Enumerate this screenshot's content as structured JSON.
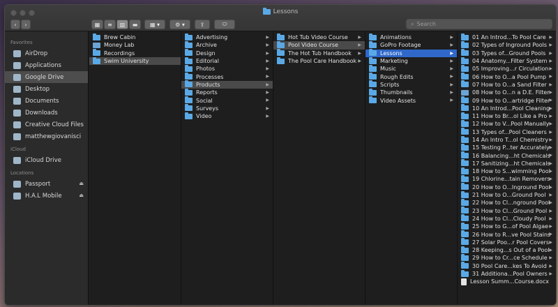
{
  "window": {
    "title": "Lessons"
  },
  "toolbar": {
    "back_label": "‹",
    "forward_label": "›",
    "view_icon_label": "▦",
    "view_list_label": "≡",
    "view_columns_label": "▥",
    "view_gallery_label": "▬",
    "group_label": "▦ ▾",
    "action_label": "⚙ ▾",
    "share_label": "⇪",
    "tag_label": "⬭",
    "search_placeholder": "Search"
  },
  "sidebar": {
    "sections": [
      {
        "heading": "Favorites",
        "items": [
          {
            "label": "AirDrop",
            "icon": "airdrop-icon"
          },
          {
            "label": "Applications",
            "icon": "applications-icon"
          },
          {
            "label": "Google Drive",
            "icon": "folder-icon",
            "selected": true
          },
          {
            "label": "Desktop",
            "icon": "desktop-icon"
          },
          {
            "label": "Documents",
            "icon": "documents-icon"
          },
          {
            "label": "Downloads",
            "icon": "downloads-icon"
          },
          {
            "label": "Creative Cloud Files",
            "icon": "creative-cloud-icon"
          },
          {
            "label": "matthewgiovanisci",
            "icon": "home-icon"
          }
        ]
      },
      {
        "heading": "iCloud",
        "items": [
          {
            "label": "iCloud Drive",
            "icon": "icloud-icon"
          }
        ]
      },
      {
        "heading": "Locations",
        "items": [
          {
            "label": "Passport",
            "icon": "disk-icon",
            "eject": true
          },
          {
            "label": "H.A.L Mobile",
            "icon": "disk-icon",
            "eject": true
          }
        ]
      }
    ]
  },
  "columns": [
    {
      "items": [
        {
          "label": "Brew Cabin",
          "icon": "folder"
        },
        {
          "label": "Money Lab",
          "icon": "picture"
        },
        {
          "label": "Recordings",
          "icon": "folder"
        },
        {
          "label": "Swim University",
          "icon": "folder",
          "selected": true
        }
      ]
    },
    {
      "items": [
        {
          "label": "Advertising",
          "icon": "folder",
          "chevron": true
        },
        {
          "label": "Archive",
          "icon": "folder",
          "chevron": true
        },
        {
          "label": "Design",
          "icon": "folder",
          "chevron": true
        },
        {
          "label": "Editorial",
          "icon": "folder",
          "chevron": true
        },
        {
          "label": "Photos",
          "icon": "folder",
          "chevron": true
        },
        {
          "label": "Processes",
          "icon": "folder",
          "chevron": true
        },
        {
          "label": "Products",
          "icon": "folder",
          "chevron": true,
          "selected": true
        },
        {
          "label": "Reports",
          "icon": "folder",
          "chevron": true
        },
        {
          "label": "Social",
          "icon": "folder",
          "chevron": true
        },
        {
          "label": "Surveys",
          "icon": "folder",
          "chevron": true
        },
        {
          "label": "Video",
          "icon": "folder",
          "chevron": true
        }
      ]
    },
    {
      "items": [
        {
          "label": "Hot Tub Video Course",
          "icon": "folder",
          "chevron": true
        },
        {
          "label": "Pool Video Course",
          "icon": "folder",
          "chevron": true,
          "selected": true
        },
        {
          "label": "The Hot Tub Handbook",
          "icon": "folder",
          "chevron": true
        },
        {
          "label": "The Pool Care Handbook",
          "icon": "folder",
          "chevron": true
        }
      ]
    },
    {
      "items": [
        {
          "label": "Animations",
          "icon": "folder",
          "chevron": true
        },
        {
          "label": "GoPro Footage",
          "icon": "folder",
          "chevron": true
        },
        {
          "label": "Lessons",
          "icon": "folder",
          "chevron": true,
          "active": true
        },
        {
          "label": "Marketing",
          "icon": "folder",
          "chevron": true
        },
        {
          "label": "Music",
          "icon": "folder",
          "chevron": true
        },
        {
          "label": "Rough Edits",
          "icon": "folder",
          "chevron": true
        },
        {
          "label": "Scripts",
          "icon": "folder",
          "chevron": true
        },
        {
          "label": "Thumbnails",
          "icon": "folder",
          "chevron": true
        },
        {
          "label": "Video Assets",
          "icon": "folder",
          "chevron": true
        }
      ]
    },
    {
      "items": [
        {
          "label": "01 An Introd...To Pool Care",
          "icon": "folder",
          "chevron": true
        },
        {
          "label": "02 Types of Inground Pools",
          "icon": "folder",
          "chevron": true
        },
        {
          "label": "03 Types of...Ground Pools",
          "icon": "folder",
          "chevron": true
        },
        {
          "label": "04 Anatomy...Filter System",
          "icon": "folder",
          "chevron": true
        },
        {
          "label": "05 Improving...r Circulation",
          "icon": "folder",
          "chevron": true
        },
        {
          "label": "06 How to O...a Pool Pump",
          "icon": "folder",
          "chevron": true
        },
        {
          "label": "07 How to O...a Sand Filter",
          "icon": "folder",
          "chevron": true
        },
        {
          "label": "08 How to O...n a D.E. Filter",
          "icon": "picture",
          "chevron": true
        },
        {
          "label": "09 How to O...artridge Filter",
          "icon": "folder",
          "chevron": true
        },
        {
          "label": "10 An Introd...Pool Cleaning",
          "icon": "folder",
          "chevron": true
        },
        {
          "label": "11 How to Br...ol Like a Pro",
          "icon": "folder",
          "chevron": true
        },
        {
          "label": "12 How to V...Pool Manually",
          "icon": "folder",
          "chevron": true
        },
        {
          "label": "13 Types of...Pool Cleaners",
          "icon": "folder",
          "chevron": true
        },
        {
          "label": "14 An Intro T...ol Chemistry",
          "icon": "folder",
          "chevron": true
        },
        {
          "label": "15 Testing P...ter Accurately",
          "icon": "folder",
          "chevron": true
        },
        {
          "label": "16 Balancing...ht Chemicals",
          "icon": "folder",
          "chevron": true
        },
        {
          "label": "17 Sanitizing...ht Chemicals",
          "icon": "folder",
          "chevron": true
        },
        {
          "label": "18 How to S...wimming Pool",
          "icon": "folder",
          "chevron": true
        },
        {
          "label": "19 Chlorine...tain Removers",
          "icon": "folder",
          "chevron": true
        },
        {
          "label": "20 How to O...Inground Pool",
          "icon": "folder",
          "chevron": true
        },
        {
          "label": "21 How to O...Ground Pool",
          "icon": "folder",
          "chevron": true
        },
        {
          "label": "22 How to Cl...nground Pool",
          "icon": "folder",
          "chevron": true
        },
        {
          "label": "23 How to Cl...Ground Pool",
          "icon": "folder",
          "chevron": true
        },
        {
          "label": "24 How to Cl...Cloudy Pool",
          "icon": "folder",
          "chevron": true
        },
        {
          "label": "25 How to G...of Pool Algae",
          "icon": "folder",
          "chevron": true
        },
        {
          "label": "26 How to R...ve Pool Stains",
          "icon": "folder",
          "chevron": true
        },
        {
          "label": "27 Solar Poo...r Pool Covers",
          "icon": "folder",
          "chevron": true
        },
        {
          "label": "28 Keeping...s Out of a Pool",
          "icon": "folder",
          "chevron": true
        },
        {
          "label": "29 How to Cr...ce Schedule",
          "icon": "folder",
          "chevron": true
        },
        {
          "label": "30 Pool Care...kes To Avoid",
          "icon": "folder",
          "chevron": true
        },
        {
          "label": "31 Additiona...Pool Owners",
          "icon": "folder",
          "chevron": true
        },
        {
          "label": "Lesson Summ...Course.docx",
          "icon": "document"
        }
      ]
    }
  ]
}
